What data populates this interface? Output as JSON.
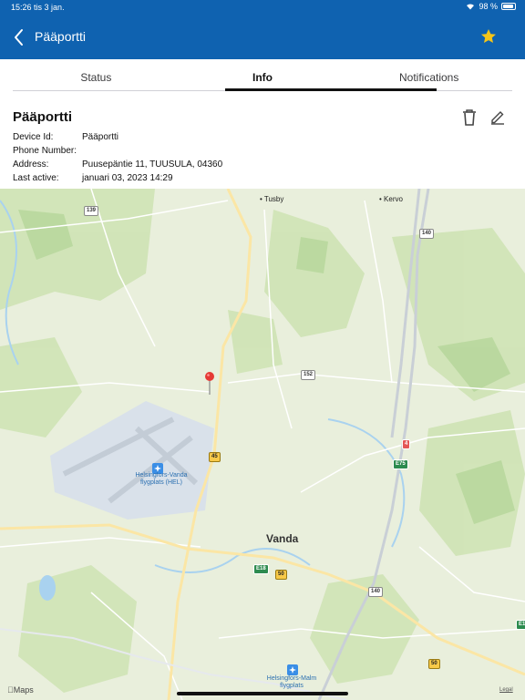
{
  "status_bar": {
    "time": "15:26",
    "date": "tis 3 jan.",
    "battery": "98 %"
  },
  "nav": {
    "title": "Pääportti",
    "back_icon": "chevron-left-icon",
    "favorite_icon": "star-icon",
    "favorite_color": "#f5c518"
  },
  "tabs": [
    {
      "label": "Status"
    },
    {
      "label": "Info",
      "active": true
    },
    {
      "label": "Notifications"
    }
  ],
  "device": {
    "name": "Pääportti",
    "fields": [
      {
        "label": "Device Id:",
        "value": "Pääportti"
      },
      {
        "label": "Phone Number:",
        "value": ""
      },
      {
        "label": "Address:",
        "value": "Puusepäntie 11, TUUSULA, 04360"
      },
      {
        "label": "Last active:",
        "value": "januari 03, 2023 14:29"
      }
    ],
    "delete_icon": "trash-icon",
    "edit_icon": "pencil-icon"
  },
  "map": {
    "places": {
      "tusby": "Tusby",
      "kervo": "Kervo",
      "vanda": "Vanda"
    },
    "airport": "Helsingfors-Vanda flygplats (HEL)",
    "malm": "Helsingfors-Malm flygplats",
    "roads": {
      "r139": "139",
      "r140a": "140",
      "r152": "152",
      "r45": "45",
      "r4": "4",
      "e75": "E75",
      "e18": "E18",
      "r50a": "50",
      "r140b": "140",
      "r50b": "50",
      "e1": "E1"
    },
    "attribution": "Maps",
    "legal": "Legal"
  },
  "colors": {
    "header": "#0f62b0",
    "map_land": "#e9efdc",
    "road": "#ffffff",
    "water": "#a9d2ef"
  }
}
